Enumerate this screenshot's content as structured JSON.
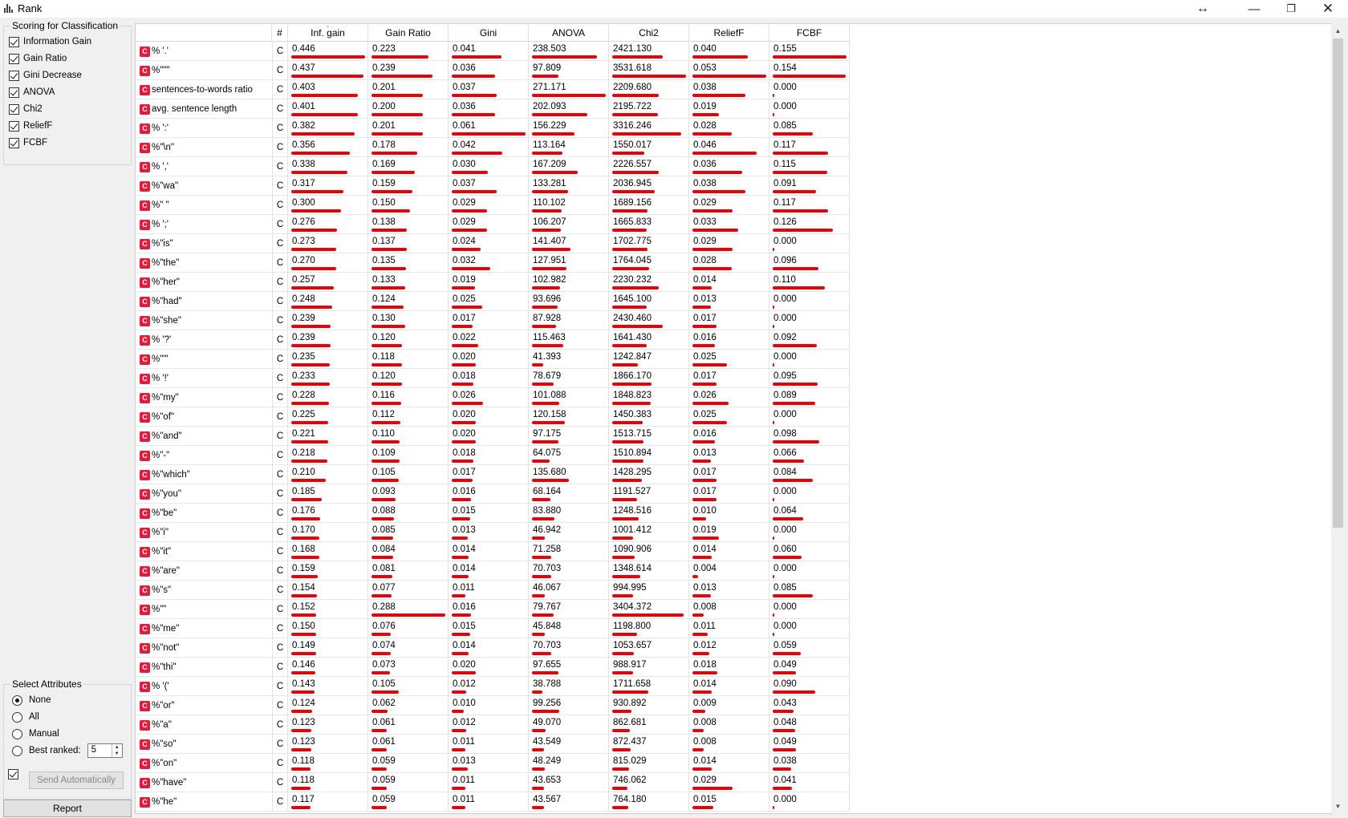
{
  "window": {
    "title": "Rank"
  },
  "scoring": {
    "title": "Scoring for Classification",
    "items": [
      {
        "label": "Information Gain",
        "checked": true
      },
      {
        "label": "Gain Ratio",
        "checked": true
      },
      {
        "label": "Gini Decrease",
        "checked": true
      },
      {
        "label": "ANOVA",
        "checked": true
      },
      {
        "label": "Chi2",
        "checked": true
      },
      {
        "label": "ReliefF",
        "checked": true
      },
      {
        "label": "FCBF",
        "checked": true
      }
    ]
  },
  "select": {
    "title": "Select Attributes",
    "options": [
      "None",
      "All",
      "Manual",
      "Best ranked:"
    ],
    "selected": "None",
    "best_ranked_value": "5",
    "send_automatically_checked": true,
    "send_label": "Send Automatically"
  },
  "report_label": "Report",
  "table": {
    "columns": [
      "#",
      "Inf. gain",
      "Gain Ratio",
      "Gini",
      "ANOVA",
      "Chi2",
      "ReliefF",
      "FCBF"
    ],
    "sorted_column": "Inf. gain",
    "bar_color": "#e8000b",
    "rows": [
      {
        "name": "% '.'",
        "type": "C",
        "v": [
          "0.446",
          "0.223",
          "0.041",
          "238.503",
          "2421.130",
          "0.040",
          "0.155"
        ]
      },
      {
        "name": "%\"\"\"",
        "type": "C",
        "v": [
          "0.437",
          "0.239",
          "0.036",
          "97.809",
          "3531.618",
          "0.053",
          "0.154"
        ]
      },
      {
        "name": "sentences-to-words ratio",
        "type": "C",
        "v": [
          "0.403",
          "0.201",
          "0.037",
          "271.171",
          "2209.680",
          "0.038",
          "0.000"
        ]
      },
      {
        "name": "avg. sentence length",
        "type": "C",
        "v": [
          "0.401",
          "0.200",
          "0.036",
          "202.093",
          "2195.722",
          "0.019",
          "0.000"
        ]
      },
      {
        "name": "% ':'",
        "type": "C",
        "v": [
          "0.382",
          "0.201",
          "0.061",
          "156.229",
          "3316.246",
          "0.028",
          "0.085"
        ]
      },
      {
        "name": "%\"\\n\"",
        "type": "C",
        "v": [
          "0.356",
          "0.178",
          "0.042",
          "113.164",
          "1550.017",
          "0.046",
          "0.117"
        ]
      },
      {
        "name": "% ','",
        "type": "C",
        "v": [
          "0.338",
          "0.169",
          "0.030",
          "167.209",
          "2226.557",
          "0.036",
          "0.115"
        ]
      },
      {
        "name": "%\"wa\"",
        "type": "C",
        "v": [
          "0.317",
          "0.159",
          "0.037",
          "133.281",
          "2036.945",
          "0.038",
          "0.091"
        ]
      },
      {
        "name": "%\" \"",
        "type": "C",
        "v": [
          "0.300",
          "0.150",
          "0.029",
          "110.102",
          "1689.156",
          "0.029",
          "0.117"
        ]
      },
      {
        "name": "% ';'",
        "type": "C",
        "v": [
          "0.276",
          "0.138",
          "0.029",
          "106.207",
          "1665.833",
          "0.033",
          "0.126"
        ]
      },
      {
        "name": "%\"is\"",
        "type": "C",
        "v": [
          "0.273",
          "0.137",
          "0.024",
          "141.407",
          "1702.775",
          "0.029",
          "0.000"
        ]
      },
      {
        "name": "%\"the\"",
        "type": "C",
        "v": [
          "0.270",
          "0.135",
          "0.032",
          "127.951",
          "1764.045",
          "0.028",
          "0.096"
        ]
      },
      {
        "name": "%\"her\"",
        "type": "C",
        "v": [
          "0.257",
          "0.133",
          "0.019",
          "102.982",
          "2230.232",
          "0.014",
          "0.110"
        ]
      },
      {
        "name": "%\"had\"",
        "type": "C",
        "v": [
          "0.248",
          "0.124",
          "0.025",
          "93.696",
          "1645.100",
          "0.013",
          "0.000"
        ]
      },
      {
        "name": "%\"she\"",
        "type": "C",
        "v": [
          "0.239",
          "0.130",
          "0.017",
          "87.928",
          "2430.460",
          "0.017",
          "0.000"
        ]
      },
      {
        "name": "% '?'",
        "type": "C",
        "v": [
          "0.239",
          "0.120",
          "0.022",
          "115.463",
          "1641.430",
          "0.016",
          "0.092"
        ]
      },
      {
        "name": "%\"'\"",
        "type": "C",
        "v": [
          "0.235",
          "0.118",
          "0.020",
          "41.393",
          "1242.847",
          "0.025",
          "0.000"
        ]
      },
      {
        "name": "% '!'",
        "type": "C",
        "v": [
          "0.233",
          "0.120",
          "0.018",
          "78.679",
          "1866.170",
          "0.017",
          "0.095"
        ]
      },
      {
        "name": "%\"my\"",
        "type": "C",
        "v": [
          "0.228",
          "0.116",
          "0.026",
          "101.088",
          "1848.823",
          "0.026",
          "0.089"
        ]
      },
      {
        "name": "%\"of\"",
        "type": "C",
        "v": [
          "0.225",
          "0.112",
          "0.020",
          "120.158",
          "1450.383",
          "0.025",
          "0.000"
        ]
      },
      {
        "name": "%\"and\"",
        "type": "C",
        "v": [
          "0.221",
          "0.110",
          "0.020",
          "97.175",
          "1513.715",
          "0.016",
          "0.098"
        ]
      },
      {
        "name": "%\"-\"",
        "type": "C",
        "v": [
          "0.218",
          "0.109",
          "0.018",
          "64.075",
          "1510.894",
          "0.013",
          "0.066"
        ]
      },
      {
        "name": "%\"which\"",
        "type": "C",
        "v": [
          "0.210",
          "0.105",
          "0.017",
          "135.680",
          "1428.295",
          "0.017",
          "0.084"
        ]
      },
      {
        "name": "%\"you\"",
        "type": "C",
        "v": [
          "0.185",
          "0.093",
          "0.016",
          "68.164",
          "1191.527",
          "0.017",
          "0.000"
        ]
      },
      {
        "name": "%\"be\"",
        "type": "C",
        "v": [
          "0.176",
          "0.088",
          "0.015",
          "83.880",
          "1248.516",
          "0.010",
          "0.064"
        ]
      },
      {
        "name": "%\"i\"",
        "type": "C",
        "v": [
          "0.170",
          "0.085",
          "0.013",
          "46.942",
          "1001.412",
          "0.019",
          "0.000"
        ]
      },
      {
        "name": "%\"it\"",
        "type": "C",
        "v": [
          "0.168",
          "0.084",
          "0.014",
          "71.258",
          "1090.906",
          "0.014",
          "0.060"
        ]
      },
      {
        "name": "%\"are\"",
        "type": "C",
        "v": [
          "0.159",
          "0.081",
          "0.014",
          "70.703",
          "1348.614",
          "0.004",
          "0.000"
        ]
      },
      {
        "name": "%\"s\"",
        "type": "C",
        "v": [
          "0.154",
          "0.077",
          "0.011",
          "46.067",
          "994.995",
          "0.013",
          "0.085"
        ]
      },
      {
        "name": "%\"\"",
        "type": "C",
        "v": [
          "0.152",
          "0.288",
          "0.016",
          "79.767",
          "3404.372",
          "0.008",
          "0.000"
        ]
      },
      {
        "name": "%\"me\"",
        "type": "C",
        "v": [
          "0.150",
          "0.076",
          "0.015",
          "45.848",
          "1198.800",
          "0.011",
          "0.000"
        ]
      },
      {
        "name": "%\"not\"",
        "type": "C",
        "v": [
          "0.149",
          "0.074",
          "0.014",
          "70.703",
          "1053.657",
          "0.012",
          "0.059"
        ]
      },
      {
        "name": "%\"thi\"",
        "type": "C",
        "v": [
          "0.146",
          "0.073",
          "0.020",
          "97.655",
          "988.917",
          "0.018",
          "0.049"
        ]
      },
      {
        "name": "% '('",
        "type": "C",
        "v": [
          "0.143",
          "0.105",
          "0.012",
          "38.788",
          "1711.658",
          "0.014",
          "0.090"
        ]
      },
      {
        "name": "%\"or\"",
        "type": "C",
        "v": [
          "0.124",
          "0.062",
          "0.010",
          "99.256",
          "930.892",
          "0.009",
          "0.043"
        ]
      },
      {
        "name": "%\"a\"",
        "type": "C",
        "v": [
          "0.123",
          "0.061",
          "0.012",
          "49.070",
          "862.681",
          "0.008",
          "0.048"
        ]
      },
      {
        "name": "%\"so\"",
        "type": "C",
        "v": [
          "0.123",
          "0.061",
          "0.011",
          "43.549",
          "872.437",
          "0.008",
          "0.049"
        ]
      },
      {
        "name": "%\"on\"",
        "type": "C",
        "v": [
          "0.118",
          "0.059",
          "0.013",
          "48.249",
          "815.029",
          "0.014",
          "0.038"
        ]
      },
      {
        "name": "%\"have\"",
        "type": "C",
        "v": [
          "0.118",
          "0.059",
          "0.011",
          "43.653",
          "746.062",
          "0.029",
          "0.041"
        ]
      },
      {
        "name": "%\"he\"",
        "type": "C",
        "v": [
          "0.117",
          "0.059",
          "0.011",
          "43.567",
          "764.180",
          "0.015",
          "0.000"
        ]
      }
    ]
  }
}
